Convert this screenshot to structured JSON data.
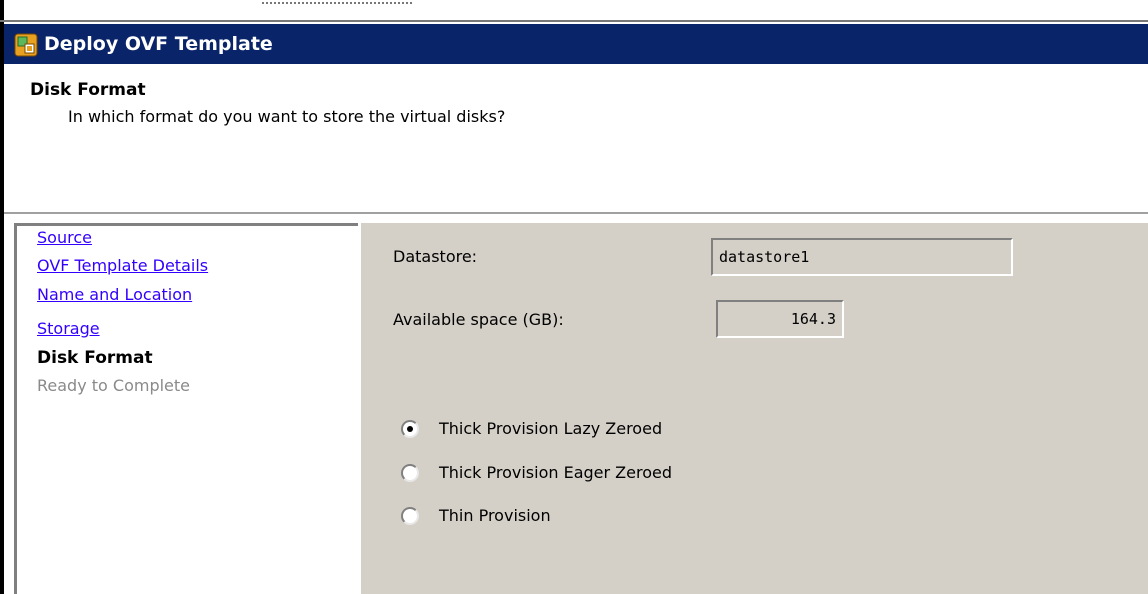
{
  "window": {
    "title": "Deploy OVF Template",
    "icon": "deploy-template-icon"
  },
  "header": {
    "title": "Disk Format",
    "subtitle": "In which format do you want to store the virtual disks?"
  },
  "nav": {
    "items": [
      {
        "label": "Source",
        "state": "link"
      },
      {
        "label": "OVF Template Details",
        "state": "link"
      },
      {
        "label": "Name and Location",
        "state": "link"
      },
      {
        "label": "Storage",
        "state": "link"
      },
      {
        "label": "Disk Format",
        "state": "current"
      },
      {
        "label": "Ready to Complete",
        "state": "disabled"
      }
    ]
  },
  "form": {
    "datastore_label": "Datastore:",
    "datastore_value": "datastore1",
    "space_label": "Available space (GB):",
    "space_value": "164.3"
  },
  "options": [
    {
      "label": "Thick Provision Lazy Zeroed",
      "selected": true
    },
    {
      "label": "Thick Provision Eager Zeroed",
      "selected": false
    },
    {
      "label": "Thin Provision",
      "selected": false
    }
  ],
  "colors": {
    "titlebar": "#0a246a",
    "link": "#3300ff",
    "panel": "#d4d0c8",
    "disabled": "#8a8a8a"
  }
}
